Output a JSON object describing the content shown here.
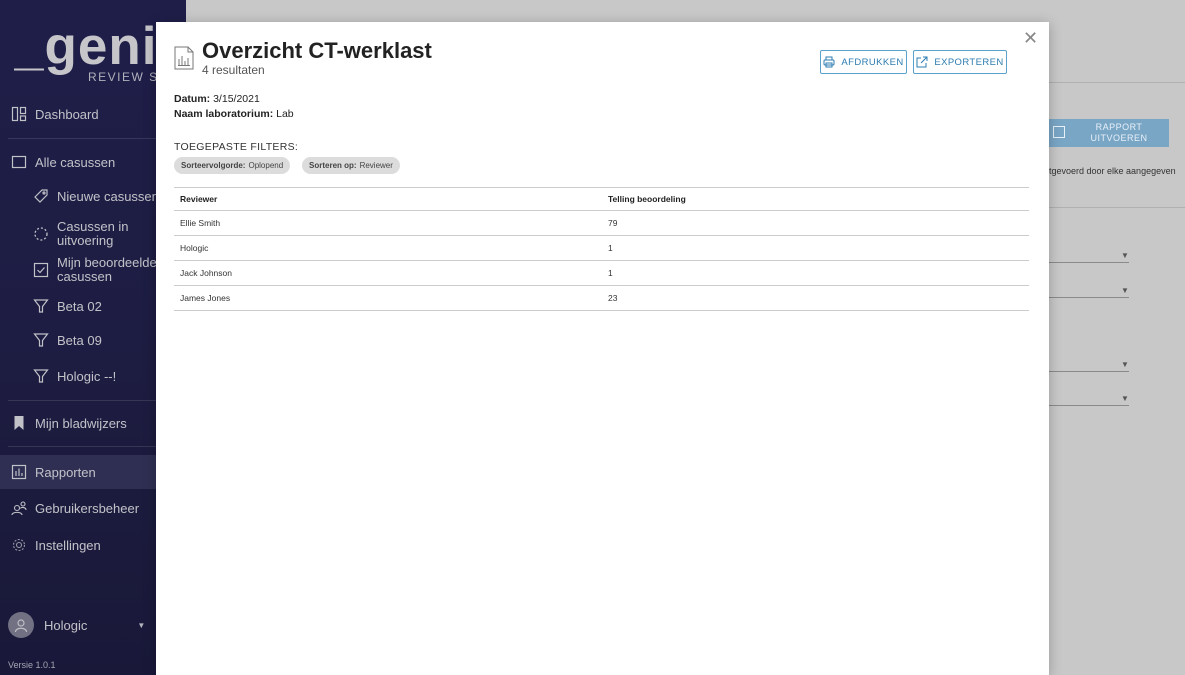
{
  "app": {
    "logo_text": "_genius",
    "logo_subtitle": "REVIEW STATIO"
  },
  "sidebar": {
    "items": [
      {
        "label": "Dashboard",
        "icon": "dashboard-icon"
      },
      {
        "label": "Alle casussen",
        "icon": "folder-icon"
      },
      {
        "label": "Nieuwe casussen",
        "icon": "tag-icon"
      },
      {
        "label": "Casussen in uitvoering",
        "icon": "progress-icon"
      },
      {
        "label": "Mijn beoordeelde casussen",
        "icon": "checkbox-icon"
      },
      {
        "label": "Beta 02",
        "icon": "filter-icon"
      },
      {
        "label": "Beta 09",
        "icon": "filter-icon"
      },
      {
        "label": "Hologic --!",
        "icon": "filter-icon"
      },
      {
        "label": "Mijn bladwijzers",
        "icon": "bookmark-icon"
      },
      {
        "label": "Rapporten",
        "icon": "report-icon"
      },
      {
        "label": "Gebruikersbeheer",
        "icon": "users-icon"
      },
      {
        "label": "Instellingen",
        "icon": "gear-icon"
      }
    ],
    "user": {
      "name": "Hologic"
    },
    "version": "Versie 1.0.1"
  },
  "background": {
    "run_report_label": "RAPPORT UITVOEREN",
    "partial_text": "tgevoerd door elke aangegeven"
  },
  "modal": {
    "title": "Overzicht CT-werklast",
    "subtitle": "4 resultaten",
    "print_label": "AFDRUKKEN",
    "export_label": "EXPORTEREN",
    "date_label": "Datum:",
    "date_value": "3/15/2021",
    "lab_label": "Naam laboratorium:",
    "lab_value": "Lab",
    "filters_heading": "TOEGEPASTE FILTERS:",
    "filters": [
      {
        "key": "Sorteervolgorde:",
        "value": "Oplopend"
      },
      {
        "key": "Sorteren op:",
        "value": "Reviewer"
      }
    ],
    "table": {
      "headers": [
        "Reviewer",
        "Telling beoordeling"
      ],
      "rows": [
        [
          "Ellie Smith",
          "79"
        ],
        [
          "Hologic",
          "1"
        ],
        [
          "Jack Johnson",
          "1"
        ],
        [
          "James Jones",
          "23"
        ]
      ]
    }
  }
}
